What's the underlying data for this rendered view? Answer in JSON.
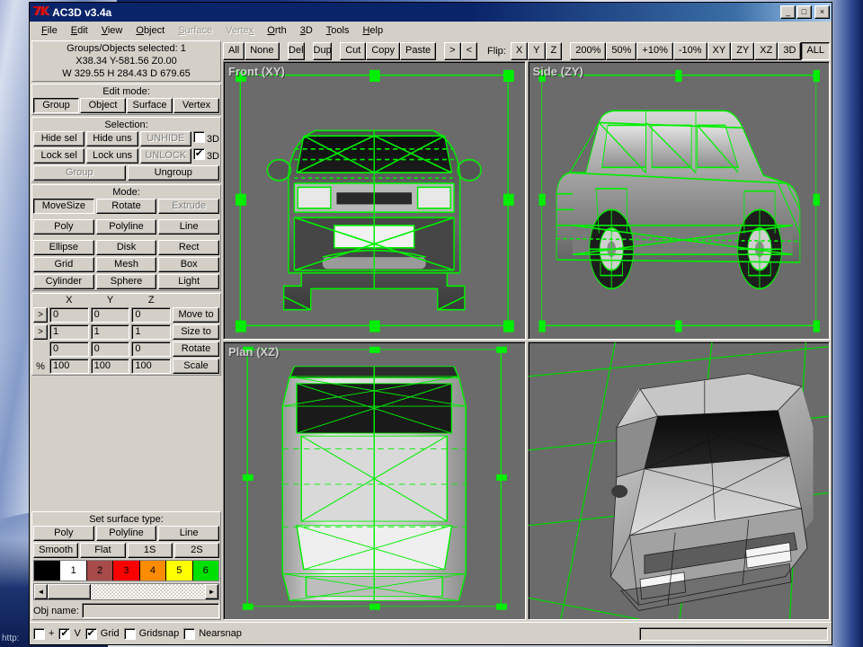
{
  "window": {
    "title": "AC3D v3.4a",
    "logo": "7K",
    "buttons": {
      "minimize": "_",
      "maximize": "□",
      "close": "×"
    }
  },
  "desktop": {
    "url_text": "http:"
  },
  "menubar": {
    "items": [
      {
        "label": "File",
        "disabled": false
      },
      {
        "label": "Edit",
        "disabled": false
      },
      {
        "label": "View",
        "disabled": false
      },
      {
        "label": "Object",
        "disabled": false
      },
      {
        "label": "Surface",
        "disabled": true
      },
      {
        "label": "Vertex",
        "disabled": true
      },
      {
        "label": "Orth",
        "disabled": false
      },
      {
        "label": "3D",
        "disabled": false
      },
      {
        "label": "Tools",
        "disabled": false
      },
      {
        "label": "Help",
        "disabled": false
      }
    ]
  },
  "info": {
    "selected_line": "Groups/Objects selected: 1",
    "position_line": "X38.34 Y-581.56 Z0.00",
    "dimension_line": "W 329.55 H 284.43 D 679.65"
  },
  "edit_mode": {
    "caption": "Edit mode:",
    "tabs": [
      {
        "label": "Group",
        "active": true
      },
      {
        "label": "Object",
        "active": false
      },
      {
        "label": "Surface",
        "active": false
      },
      {
        "label": "Vertex",
        "active": false
      }
    ]
  },
  "selection": {
    "caption": "Selection:",
    "hide_sel": "Hide sel",
    "hide_uns": "Hide uns",
    "unhide": "UNHIDE",
    "unhide_disabled": true,
    "hide_3d_label": "3D",
    "hide_3d_checked": false,
    "lock_sel": "Lock sel",
    "lock_uns": "Lock uns",
    "unlock": "UNLOCK",
    "unlock_disabled": true,
    "lock_3d_label": "3D",
    "lock_3d_checked": true,
    "group": "Group",
    "group_disabled": true,
    "ungroup": "Ungroup"
  },
  "mode": {
    "caption": "Mode:",
    "primary": [
      {
        "label": "MoveSize",
        "active": true,
        "disabled": false
      },
      {
        "label": "Rotate",
        "active": false,
        "disabled": false
      },
      {
        "label": "Extrude",
        "active": false,
        "disabled": true
      }
    ],
    "line_tools": [
      "Poly",
      "Polyline",
      "Line"
    ],
    "shape_tools": [
      [
        "Ellipse",
        "Disk",
        "Rect"
      ],
      [
        "Grid",
        "Mesh",
        "Box"
      ],
      [
        "Cylinder",
        "Sphere",
        "Light"
      ]
    ]
  },
  "transform": {
    "headers": [
      "X",
      "Y",
      "Z"
    ],
    "arrow_glyph": ">",
    "rows": [
      {
        "name": "move",
        "has_arrow": true,
        "prefix": "",
        "values": [
          "0",
          "0",
          "0"
        ],
        "action": "Move to"
      },
      {
        "name": "size",
        "has_arrow": true,
        "prefix": "",
        "values": [
          "1",
          "1",
          "1"
        ],
        "action": "Size to"
      },
      {
        "name": "rotate",
        "has_arrow": false,
        "prefix": "",
        "values": [
          "0",
          "0",
          "0"
        ],
        "action": "Rotate"
      },
      {
        "name": "scale",
        "has_arrow": false,
        "prefix": "%",
        "values": [
          "100",
          "100",
          "100"
        ],
        "action": "Scale"
      }
    ]
  },
  "surface_type": {
    "caption": "Set surface type:",
    "row1": [
      "Poly",
      "Polyline",
      "Line"
    ],
    "row2": [
      "Smooth",
      "Flat",
      "1S",
      "2S"
    ]
  },
  "palette": {
    "swatches": [
      {
        "label": "",
        "color": "#000000",
        "text": "#ffffff"
      },
      {
        "label": "1",
        "color": "#ffffff",
        "text": "#000000"
      },
      {
        "label": "2",
        "color": "#a64a4a",
        "text": "#000000"
      },
      {
        "label": "3",
        "color": "#fc0000",
        "text": "#000000"
      },
      {
        "label": "4",
        "color": "#ff8c00",
        "text": "#000000"
      },
      {
        "label": "5",
        "color": "#ffff00",
        "text": "#000000"
      },
      {
        "label": "6",
        "color": "#00e000",
        "text": "#000000"
      }
    ],
    "scroll_left": "◄",
    "scroll_right": "►"
  },
  "objname": {
    "label": "Obj name:",
    "value": ""
  },
  "toolbar": {
    "select_group": [
      "All",
      "None"
    ],
    "del": "Del",
    "dup": "Dup",
    "clipboard": [
      "Cut",
      "Copy",
      "Paste"
    ],
    "nav": [
      ">",
      "<"
    ],
    "flip_label": "Flip:",
    "flip_axes": [
      "X",
      "Y",
      "Z"
    ],
    "zoom": [
      "200%",
      "50%",
      "+10%",
      "-10%"
    ],
    "views": [
      {
        "label": "XY",
        "active": false
      },
      {
        "label": "ZY",
        "active": false
      },
      {
        "label": "XZ",
        "active": false
      },
      {
        "label": "3D",
        "active": false
      },
      {
        "label": "ALL",
        "active": true
      }
    ]
  },
  "viewports": [
    {
      "name": "front",
      "label": "Front (XY)"
    },
    {
      "name": "side",
      "label": "Side (ZY)"
    },
    {
      "name": "plan",
      "label": "Plan (XZ)"
    },
    {
      "name": "persp",
      "label": ""
    }
  ],
  "statusbar": {
    "toggles": [
      {
        "label": "+",
        "checked": false
      },
      {
        "label": "V",
        "checked": true
      },
      {
        "label": "Grid",
        "checked": true
      },
      {
        "label": "Gridsnap",
        "checked": false
      },
      {
        "label": "Nearsnap",
        "checked": false
      }
    ],
    "input_value": ""
  },
  "colors": {
    "face": "#d4d0c8",
    "viewport_bg": "#6b6b6b",
    "wireframe": "#00ee00",
    "titlebar": "#0a246a"
  }
}
